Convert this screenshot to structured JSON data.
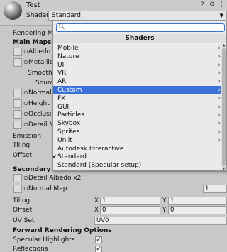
{
  "header": {
    "title": "Test",
    "shader_label": "Shader",
    "shader_value": "Standard"
  },
  "sections": {
    "rendering_mode": "Rendering Mo",
    "main_maps": "Main Maps",
    "secondary_maps": "Secondary M",
    "forward": "Forward Rendering Options"
  },
  "main": {
    "albedo": "Albedo",
    "metallic": "Metallic",
    "smoothness": "Smoothn",
    "source": "Sourc",
    "normal": "Normal I",
    "height": "Height M",
    "occlusion": "Occlusio",
    "detail_mask": "Detail M",
    "emission": "Emission",
    "tiling": "Tiling",
    "offset": "Offset"
  },
  "secondary": {
    "detail_albedo": "Detail Albedo x2",
    "normal_map": "Normal Map",
    "normal_value": "1",
    "tiling": "Tiling",
    "offset": "Offset",
    "tiling_x": "1",
    "tiling_y": "1",
    "offset_x": "0",
    "offset_y": "0",
    "axis_x": "X",
    "axis_y": "Y",
    "uv_set": "UV Set",
    "uv_value": "UV0"
  },
  "forward": {
    "specular": "Specular Highlights",
    "reflections": "Reflections"
  },
  "dropdown": {
    "header": "Shaders",
    "search_value": "",
    "items": [
      {
        "label": "Mobile",
        "submenu": true
      },
      {
        "label": "Nature",
        "submenu": true
      },
      {
        "label": "UI",
        "submenu": true
      },
      {
        "label": "VR",
        "submenu": true
      },
      {
        "label": "AR",
        "submenu": true
      },
      {
        "label": "Custom",
        "submenu": true,
        "selected": true
      },
      {
        "label": "FX",
        "submenu": true
      },
      {
        "label": "GUI",
        "submenu": true
      },
      {
        "label": "Particles",
        "submenu": true
      },
      {
        "label": "Skybox",
        "submenu": true
      },
      {
        "label": "Sprites",
        "submenu": true
      },
      {
        "label": "Unlit",
        "submenu": true
      },
      {
        "label": "Autodesk Interactive",
        "submenu": false
      },
      {
        "label": "Standard",
        "submenu": false,
        "checked": true
      },
      {
        "label": "Standard (Specular setup)",
        "submenu": false
      }
    ]
  },
  "icons": {
    "material_preview": "sphere-icon",
    "help": "help-icon",
    "settings": "settings-icon",
    "menu": "more-icon",
    "search": "search-icon",
    "submenu": "chevron-right-icon",
    "checkmark": "checkmark-icon"
  },
  "colors": {
    "selection": "#3a72d8",
    "background": "#c8c8c8"
  }
}
